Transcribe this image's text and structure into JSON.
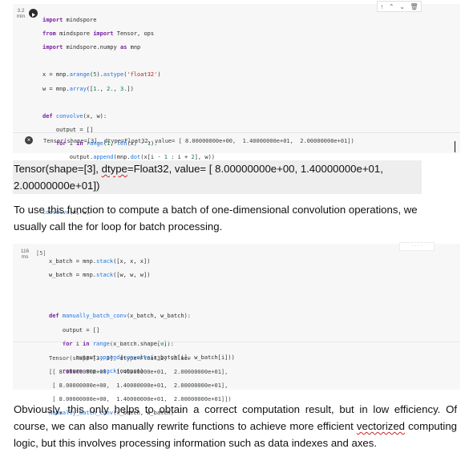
{
  "cell1": {
    "time": "3.2",
    "time_unit": "min",
    "toolbar_icons": [
      "up-arrow-icon",
      "chevron-up-icon",
      "chevron-down-icon",
      "trash-icon"
    ],
    "output_status_icon": "error-circle-icon",
    "output": "Tensor(shape=[3], dtype=Float32, value= [ 8.00000000e+00,  1.40000000e+01,  2.00000000e+01])"
  },
  "tensor_repr": {
    "line1_prefix": "Tensor(shape=[3], ",
    "line1_dtype": "dtype",
    "line1_rest": "=Float32, value= [ 8.00000000e+00,    1.40000000e+01,",
    "line2": "2.00000000e+01])"
  },
  "para1": "To use this function to compute a batch of one-dimensional convolution operations, we usually call the for loop for batch processing.",
  "cell2": {
    "time": "116",
    "time_unit": "ms",
    "exec_count": "[5]",
    "output_lines": [
      "Tensor(shape=[3, 3], dtype=Float32, value=",
      "[[ 8.00000000e+00,  1.40000000e+01,  2.00000000e+01],",
      " [ 8.00000000e+00,  1.40000000e+01,  2.00000000e+01],",
      " [ 8.00000000e+00,  1.40000000e+01,  2.00000000e+01]])"
    ]
  },
  "para2": {
    "before": "Obviously, this only helps to obtain a correct computation result, but in low efficiency. Of course, we can also manually rewrite functions to achieve more efficient ",
    "squiggle_word": "vectorized",
    "after": " computing logic, but this involves processing information such as data indexes and axes."
  }
}
